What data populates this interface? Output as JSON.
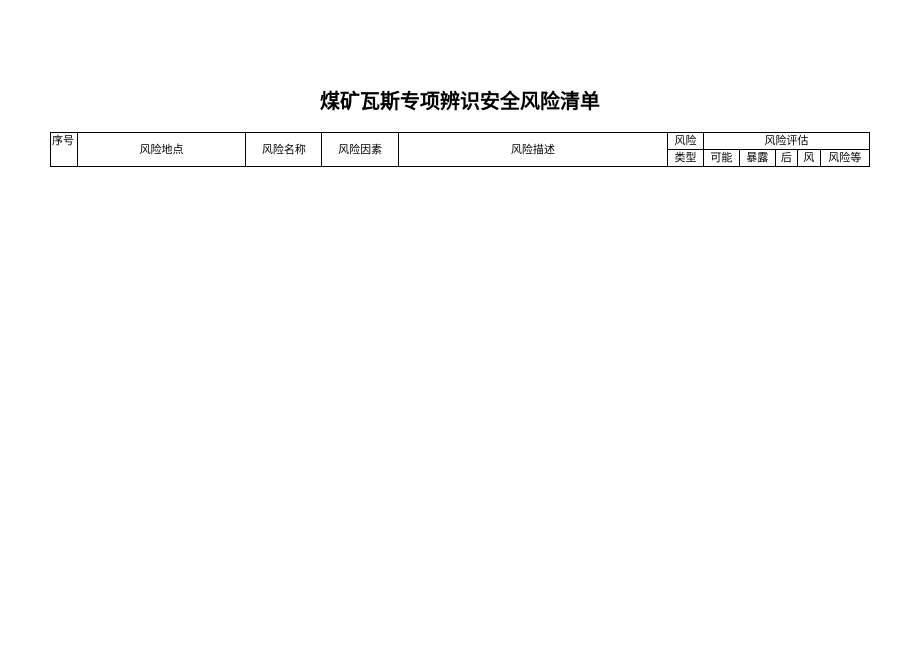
{
  "document": {
    "title": "煤矿瓦斯专项辨识安全风险清单"
  },
  "table": {
    "headers": {
      "seq": "序号",
      "location": "风险地点",
      "name": "风险名称",
      "factor": "风险因素",
      "desc": "风险描述",
      "risk_top": "风险",
      "type": "类型",
      "assessment_group": "风险评估",
      "possible": "可能",
      "exposure": "暴露",
      "after": "后",
      "wind": "风",
      "risk_level": "风险等"
    }
  }
}
